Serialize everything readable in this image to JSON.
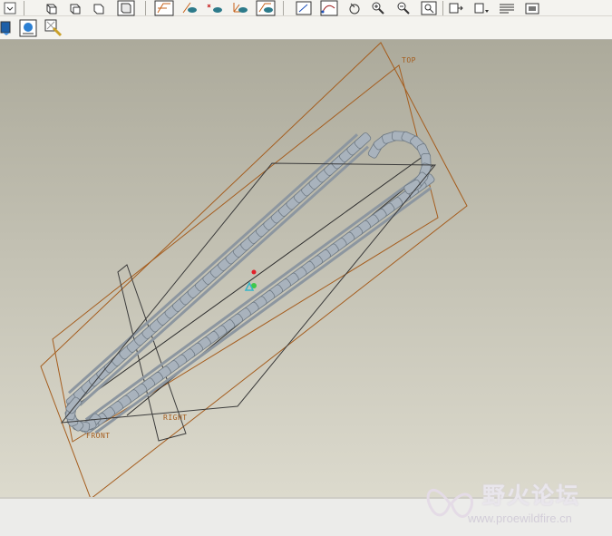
{
  "toolbar": {
    "row1_icons": [
      "view-dropdown-icon",
      "wireframe-icon",
      "hidden-line-icon",
      "no-hidden-icon",
      "shading-icon",
      "datum-plane-display-icon",
      "datum-axis-display-icon",
      "point-display-icon",
      "csys-display-icon",
      "annotation-display-icon",
      "sketch-tool-icon",
      "curve-tool-icon",
      "repaint-icon",
      "zoom-in-icon",
      "zoom-out-icon",
      "refit-icon",
      "orient-icon",
      "saved-views-icon",
      "layers-icon",
      "model-tree-icon"
    ],
    "row2_icons": [
      "spin-center-icon",
      "view-manager-icon",
      "appearance-icon"
    ]
  },
  "viewport": {
    "datum_planes": [
      "TOP",
      "RIGHT",
      "FRONT"
    ],
    "colors": {
      "datum_plane": "#a55d1e",
      "chain_link": "#a9b3bd",
      "chain_edge": "#6f7a84",
      "background_top": "#acaa9b",
      "background_bottom": "#dcdacd"
    }
  },
  "watermark": {
    "title": "野火论坛",
    "url": "www.proewildfire.cn"
  }
}
